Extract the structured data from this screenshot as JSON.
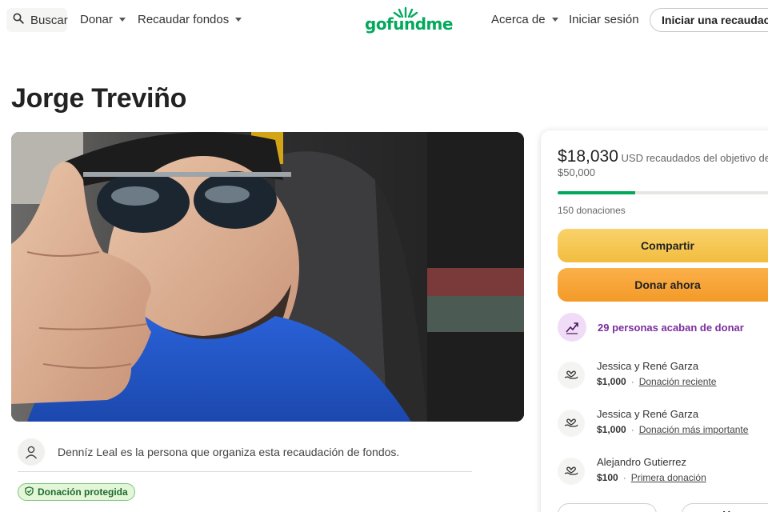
{
  "header": {
    "search_label": "Buscar",
    "donate_label": "Donar",
    "fundraise_label": "Recaudar fondos",
    "logo_text": "gofundme",
    "about_label": "Acerca de",
    "signin_label": "Iniciar sesión",
    "start_label": "Iniciar una recaudac"
  },
  "page": {
    "title": "Jorge Treviño"
  },
  "organizer": {
    "text": "Denníz Leal es la persona que organiza esta recaudación de fondos."
  },
  "badge": {
    "label": "Donación protegida"
  },
  "campaign": {
    "amount": "$18,030",
    "raised_text": "USD recaudados del objetivo de $50,000",
    "progress_fraction": 0.36,
    "donations_count": "150 donaciones",
    "share_label": "Compartir",
    "donate_now_label": "Donar ahora",
    "recent_donors_text": "29 personas acaban de donar"
  },
  "donors": [
    {
      "name": "Jessica y René Garza",
      "amount": "$1,000",
      "tag": "Donación reciente"
    },
    {
      "name": "Jessica y René Garza",
      "amount": "$1,000",
      "tag": "Donación más importante"
    },
    {
      "name": "Alejandro Gutierrez",
      "amount": "$100",
      "tag": "Primera donación"
    }
  ],
  "bottom": {
    "see_label": "Ver"
  },
  "colors": {
    "brand": "#02a95c",
    "share_button": "#f5c44f",
    "donate_button": "#f7a636",
    "recent_text": "#7a2d9c"
  },
  "icons": {
    "search": "search-icon",
    "trend": "trending-up-icon",
    "donor": "heart-hand-icon",
    "organizer": "user-icon",
    "badge": "shield-check-icon"
  }
}
